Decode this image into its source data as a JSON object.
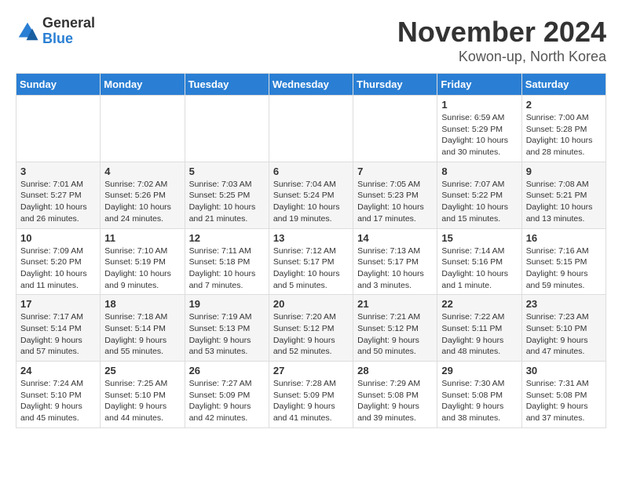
{
  "logo": {
    "general": "General",
    "blue": "Blue"
  },
  "title": "November 2024",
  "location": "Kowon-up, North Korea",
  "weekdays": [
    "Sunday",
    "Monday",
    "Tuesday",
    "Wednesday",
    "Thursday",
    "Friday",
    "Saturday"
  ],
  "weeks": [
    [
      {
        "day": "",
        "info": ""
      },
      {
        "day": "",
        "info": ""
      },
      {
        "day": "",
        "info": ""
      },
      {
        "day": "",
        "info": ""
      },
      {
        "day": "",
        "info": ""
      },
      {
        "day": "1",
        "info": "Sunrise: 6:59 AM\nSunset: 5:29 PM\nDaylight: 10 hours and 30 minutes."
      },
      {
        "day": "2",
        "info": "Sunrise: 7:00 AM\nSunset: 5:28 PM\nDaylight: 10 hours and 28 minutes."
      }
    ],
    [
      {
        "day": "3",
        "info": "Sunrise: 7:01 AM\nSunset: 5:27 PM\nDaylight: 10 hours and 26 minutes."
      },
      {
        "day": "4",
        "info": "Sunrise: 7:02 AM\nSunset: 5:26 PM\nDaylight: 10 hours and 24 minutes."
      },
      {
        "day": "5",
        "info": "Sunrise: 7:03 AM\nSunset: 5:25 PM\nDaylight: 10 hours and 21 minutes."
      },
      {
        "day": "6",
        "info": "Sunrise: 7:04 AM\nSunset: 5:24 PM\nDaylight: 10 hours and 19 minutes."
      },
      {
        "day": "7",
        "info": "Sunrise: 7:05 AM\nSunset: 5:23 PM\nDaylight: 10 hours and 17 minutes."
      },
      {
        "day": "8",
        "info": "Sunrise: 7:07 AM\nSunset: 5:22 PM\nDaylight: 10 hours and 15 minutes."
      },
      {
        "day": "9",
        "info": "Sunrise: 7:08 AM\nSunset: 5:21 PM\nDaylight: 10 hours and 13 minutes."
      }
    ],
    [
      {
        "day": "10",
        "info": "Sunrise: 7:09 AM\nSunset: 5:20 PM\nDaylight: 10 hours and 11 minutes."
      },
      {
        "day": "11",
        "info": "Sunrise: 7:10 AM\nSunset: 5:19 PM\nDaylight: 10 hours and 9 minutes."
      },
      {
        "day": "12",
        "info": "Sunrise: 7:11 AM\nSunset: 5:18 PM\nDaylight: 10 hours and 7 minutes."
      },
      {
        "day": "13",
        "info": "Sunrise: 7:12 AM\nSunset: 5:17 PM\nDaylight: 10 hours and 5 minutes."
      },
      {
        "day": "14",
        "info": "Sunrise: 7:13 AM\nSunset: 5:17 PM\nDaylight: 10 hours and 3 minutes."
      },
      {
        "day": "15",
        "info": "Sunrise: 7:14 AM\nSunset: 5:16 PM\nDaylight: 10 hours and 1 minute."
      },
      {
        "day": "16",
        "info": "Sunrise: 7:16 AM\nSunset: 5:15 PM\nDaylight: 9 hours and 59 minutes."
      }
    ],
    [
      {
        "day": "17",
        "info": "Sunrise: 7:17 AM\nSunset: 5:14 PM\nDaylight: 9 hours and 57 minutes."
      },
      {
        "day": "18",
        "info": "Sunrise: 7:18 AM\nSunset: 5:14 PM\nDaylight: 9 hours and 55 minutes."
      },
      {
        "day": "19",
        "info": "Sunrise: 7:19 AM\nSunset: 5:13 PM\nDaylight: 9 hours and 53 minutes."
      },
      {
        "day": "20",
        "info": "Sunrise: 7:20 AM\nSunset: 5:12 PM\nDaylight: 9 hours and 52 minutes."
      },
      {
        "day": "21",
        "info": "Sunrise: 7:21 AM\nSunset: 5:12 PM\nDaylight: 9 hours and 50 minutes."
      },
      {
        "day": "22",
        "info": "Sunrise: 7:22 AM\nSunset: 5:11 PM\nDaylight: 9 hours and 48 minutes."
      },
      {
        "day": "23",
        "info": "Sunrise: 7:23 AM\nSunset: 5:10 PM\nDaylight: 9 hours and 47 minutes."
      }
    ],
    [
      {
        "day": "24",
        "info": "Sunrise: 7:24 AM\nSunset: 5:10 PM\nDaylight: 9 hours and 45 minutes."
      },
      {
        "day": "25",
        "info": "Sunrise: 7:25 AM\nSunset: 5:10 PM\nDaylight: 9 hours and 44 minutes."
      },
      {
        "day": "26",
        "info": "Sunrise: 7:27 AM\nSunset: 5:09 PM\nDaylight: 9 hours and 42 minutes."
      },
      {
        "day": "27",
        "info": "Sunrise: 7:28 AM\nSunset: 5:09 PM\nDaylight: 9 hours and 41 minutes."
      },
      {
        "day": "28",
        "info": "Sunrise: 7:29 AM\nSunset: 5:08 PM\nDaylight: 9 hours and 39 minutes."
      },
      {
        "day": "29",
        "info": "Sunrise: 7:30 AM\nSunset: 5:08 PM\nDaylight: 9 hours and 38 minutes."
      },
      {
        "day": "30",
        "info": "Sunrise: 7:31 AM\nSunset: 5:08 PM\nDaylight: 9 hours and 37 minutes."
      }
    ]
  ]
}
